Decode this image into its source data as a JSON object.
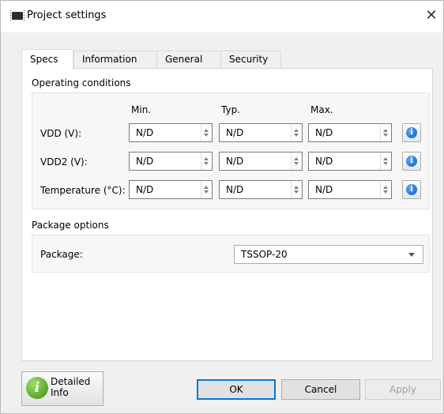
{
  "window": {
    "title": "Project settings",
    "close_glyph": "✕"
  },
  "tabs": [
    {
      "label": "Specs",
      "active": true
    },
    {
      "label": "Information",
      "active": false
    },
    {
      "label": "General",
      "active": false
    },
    {
      "label": "Security",
      "active": false
    }
  ],
  "operating": {
    "title": "Operating conditions",
    "columns": [
      "Min.",
      "Typ.",
      "Max."
    ],
    "rows": [
      {
        "label": "VDD (V):",
        "values": [
          "N/D",
          "N/D",
          "N/D"
        ]
      },
      {
        "label": "VDD2 (V):",
        "values": [
          "N/D",
          "N/D",
          "N/D"
        ]
      },
      {
        "label": "Temperature (°C):",
        "values": [
          "N/D",
          "N/D",
          "N/D"
        ]
      }
    ],
    "info_glyph": "i"
  },
  "package": {
    "title": "Package options",
    "label": "Package:",
    "selected": "TSSOP-20"
  },
  "footer": {
    "detailed_line1": "Detailed",
    "detailed_line2": "Info",
    "detailed_glyph": "i",
    "ok": "OK",
    "cancel": "Cancel",
    "apply": "Apply"
  },
  "icons": {
    "app": "chip-icon",
    "close": "close-icon",
    "info": "info-icon",
    "spin": "spin-arrows-icon",
    "dropdown": "chevron-down-icon"
  },
  "colors": {
    "info_blue": "#0a5cc4",
    "detailed_green": "#3a8f16",
    "focus_border": "#0078d7"
  }
}
